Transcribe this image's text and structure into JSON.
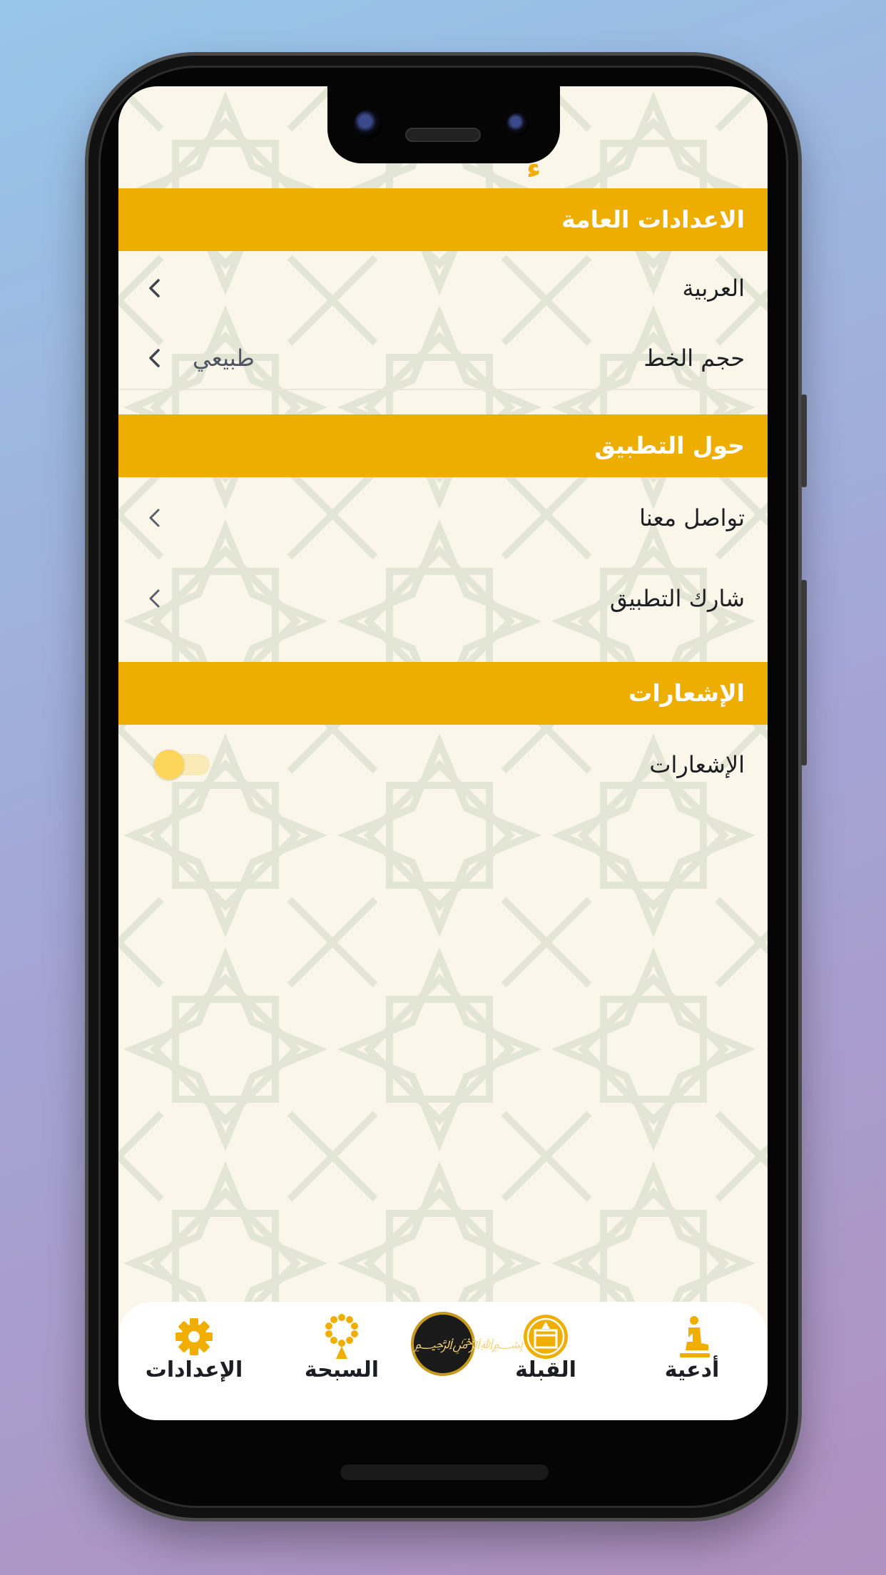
{
  "app": {
    "title_fragment": "ء"
  },
  "sections": {
    "general": {
      "header": "الاعدادات العامة",
      "language": {
        "label": "العربية"
      },
      "font_size": {
        "label": "حجم الخط",
        "value": "طبيعي"
      }
    },
    "about": {
      "header": "حول التطبيق",
      "contact": {
        "label": "تواصل معنا"
      },
      "share": {
        "label": "شارك التطبيق"
      }
    },
    "notifications": {
      "header": "الإشعارات",
      "toggle": {
        "label": "الإشعارات",
        "enabled": false
      }
    }
  },
  "tabbar": {
    "items": [
      {
        "label": "الإعدادات",
        "icon": "gear-icon"
      },
      {
        "label": "السبحة",
        "icon": "prayer-beads-icon"
      },
      {
        "label": "",
        "icon": "app-logo"
      },
      {
        "label": "القبلة",
        "icon": "kaaba-icon"
      },
      {
        "label": "أدعية",
        "icon": "praying-person-icon"
      }
    ]
  },
  "colors": {
    "accent": "#edae00",
    "background": "#faf7ea",
    "text": "#1d1d24",
    "toggle_off_track": "#faeab8",
    "toggle_knob": "#fdd55a"
  }
}
